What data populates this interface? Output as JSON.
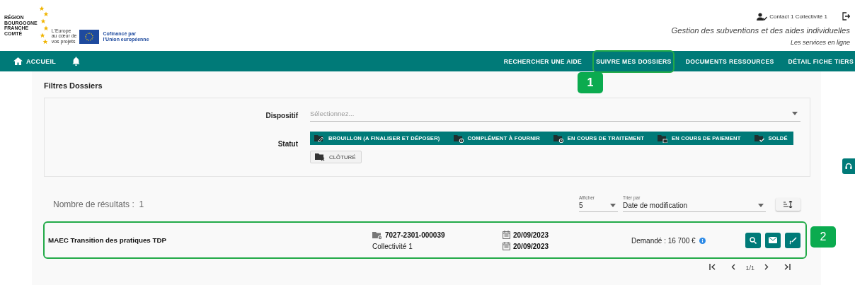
{
  "header": {
    "logo": {
      "region_lines": [
        "RÉGION",
        "BOURGOGNE",
        "FRANCHE",
        "COMTÉ"
      ],
      "slogan_lines": [
        "L'Europe",
        "au cœur de",
        "vos projets"
      ],
      "eu_lines": [
        "Cofinancé par",
        "l'Union européenne"
      ]
    },
    "user": "Contact 1 Collectivité 1",
    "title": "Gestion des subventions et des aides individuelles",
    "subtitle": "Les services en ligne"
  },
  "nav": {
    "home": "ACCUEIL",
    "items": [
      {
        "label": "RECHERCHER UNE AIDE"
      },
      {
        "label": "SUIVRE MES DOSSIERS",
        "callout": "1"
      },
      {
        "label": "DOCUMENTS RESSOURCES"
      },
      {
        "label": "DÉTAIL FICHE TIERS"
      }
    ]
  },
  "filters": {
    "title": "Filtres Dossiers",
    "dispositif": {
      "label": "Dispositif",
      "placeholder": "Sélectionnez..."
    },
    "statut": {
      "label": "Statut",
      "chips": [
        {
          "label": "BROUILLON (A FINALISER ET DÉPOSER)",
          "kind": "draft",
          "selected": true
        },
        {
          "label": "COMPLÉMENT À FOURNIR",
          "kind": "missing",
          "selected": true
        },
        {
          "label": "EN COURS DE TRAITEMENT",
          "kind": "processing",
          "selected": true
        },
        {
          "label": "EN COURS DE PAIEMENT",
          "kind": "payment",
          "selected": true
        },
        {
          "label": "SOLDÉ",
          "kind": "paid",
          "selected": true
        },
        {
          "label": "CLÔTURÉ",
          "kind": "closed",
          "selected": false
        }
      ]
    }
  },
  "results": {
    "count_label": "Nombre de résultats :",
    "count": "1",
    "page_size": {
      "label": "Afficher",
      "value": "5"
    },
    "sort": {
      "label": "Trier par",
      "value": "Date de modification"
    },
    "rows": [
      {
        "title": "MAEC Transition des pratiques TDP",
        "number": "7027-2301-000039",
        "beneficiary": "Collectivité 1",
        "created": "20/09/2023",
        "modified": "20/09/2023",
        "amount": "Demandé : 16 700 €",
        "callout": "2"
      }
    ],
    "pagination": {
      "page": "1/1"
    }
  }
}
